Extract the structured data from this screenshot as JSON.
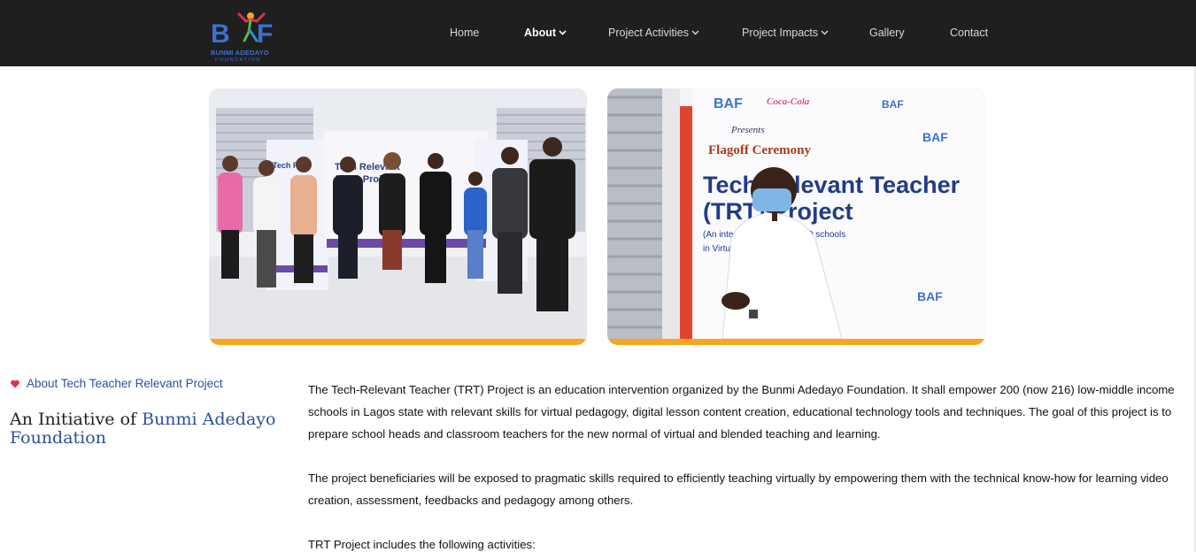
{
  "brand": {
    "logo_letters": "BAF",
    "name_line1": "BUNMI ADEDAYO",
    "name_line2": "FOUNDATION"
  },
  "nav": {
    "items": [
      {
        "label": "Home",
        "active": false,
        "dropdown": false
      },
      {
        "label": "About",
        "active": true,
        "dropdown": true
      },
      {
        "label": "Project Activities",
        "active": false,
        "dropdown": true
      },
      {
        "label": "Project Impacts",
        "active": false,
        "dropdown": true
      },
      {
        "label": "Gallery",
        "active": false,
        "dropdown": false
      },
      {
        "label": "Contact",
        "active": false,
        "dropdown": false
      }
    ],
    "chevron": "⌄"
  },
  "photos": {
    "group_photo": {
      "banner_title": "Tech Relevant Teacher (TRT) Project",
      "accent_color": "#f6a623"
    },
    "speaker_photo": {
      "banner_presents": "Presents",
      "banner_ceremony": "Flagoff Ceremony",
      "banner_title_line1": "Tech Relevant Teacher",
      "banner_title_line2": "(TRT) Project",
      "banner_sub1": "(An intensive ... ment of 200 schools",
      "banner_sub2": "in Virtual T... chnology)",
      "sponsor": "Coca-Cola"
    }
  },
  "intro": {
    "eyebrow": "About Tech Teacher Relevant Project",
    "headline_prefix": "An Initiative of ",
    "headline_accent": "Bunmi Adedayo Foundation"
  },
  "body": {
    "paragraph1": "The Tech-Relevant Teacher (TRT) Project is an education intervention organized by the Bunmi Adedayo Foundation. It shall empower 200 (now 216) low-middle income schools in Lagos state with relevant skills for virtual pedagogy, digital lesson content creation, educational technology tools and techniques. The goal of this project is to prepare school heads and classroom teachers for the new normal of virtual and blended teaching and learning.",
    "paragraph2": "The project beneficiaries will be exposed to pragmatic skills required to efficiently teaching virtually by empowering them with the technical know-how for learning video creation, assessment, feedbacks and pedagogy among others.",
    "paragraph3": "TRT Project includes the following activities:"
  },
  "colors": {
    "header_bg": "#1f1f1f",
    "accent_blue": "#2c4f9e",
    "accent_orange": "#f6a623",
    "heart_red": "#e0314b"
  }
}
